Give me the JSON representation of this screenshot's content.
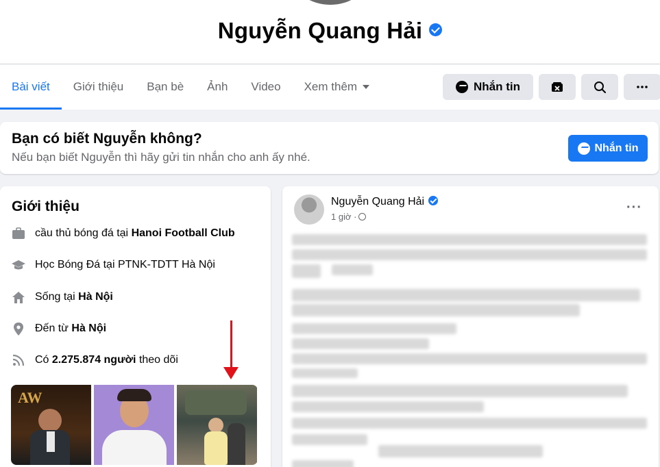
{
  "profile": {
    "name": "Nguyễn Quang Hải"
  },
  "tabs": [
    {
      "label": "Bài viết"
    },
    {
      "label": "Giới thiệu"
    },
    {
      "label": "Bạn bè"
    },
    {
      "label": "Ảnh"
    },
    {
      "label": "Video"
    },
    {
      "label": "Xem thêm"
    }
  ],
  "actions": {
    "message_label": "Nhắn tin"
  },
  "suggest": {
    "title": "Bạn có biết Nguyễn không?",
    "subtitle": "Nếu bạn biết Nguyễn thì hãy gửi tin nhắn cho anh ấy nhé.",
    "button_label": "Nhắn tin"
  },
  "intro": {
    "title": "Giới thiệu",
    "work_prefix": "cầu thủ bóng đá tại",
    "work_place": "Hanoi Football Club",
    "study": "Học Bóng Đá tại PTNK-TDTT Hà Nội",
    "lives_prefix": "Sống tại",
    "lives_place": "Hà Nội",
    "from_prefix": "Đến từ",
    "from_place": "Hà Nội",
    "followers_prefix": "Có",
    "followers_count": "2.275.874 người",
    "followers_suffix": "theo dõi"
  },
  "post": {
    "author": "Nguyễn Quang Hải",
    "time": "1 giờ ·",
    "more": "···"
  }
}
